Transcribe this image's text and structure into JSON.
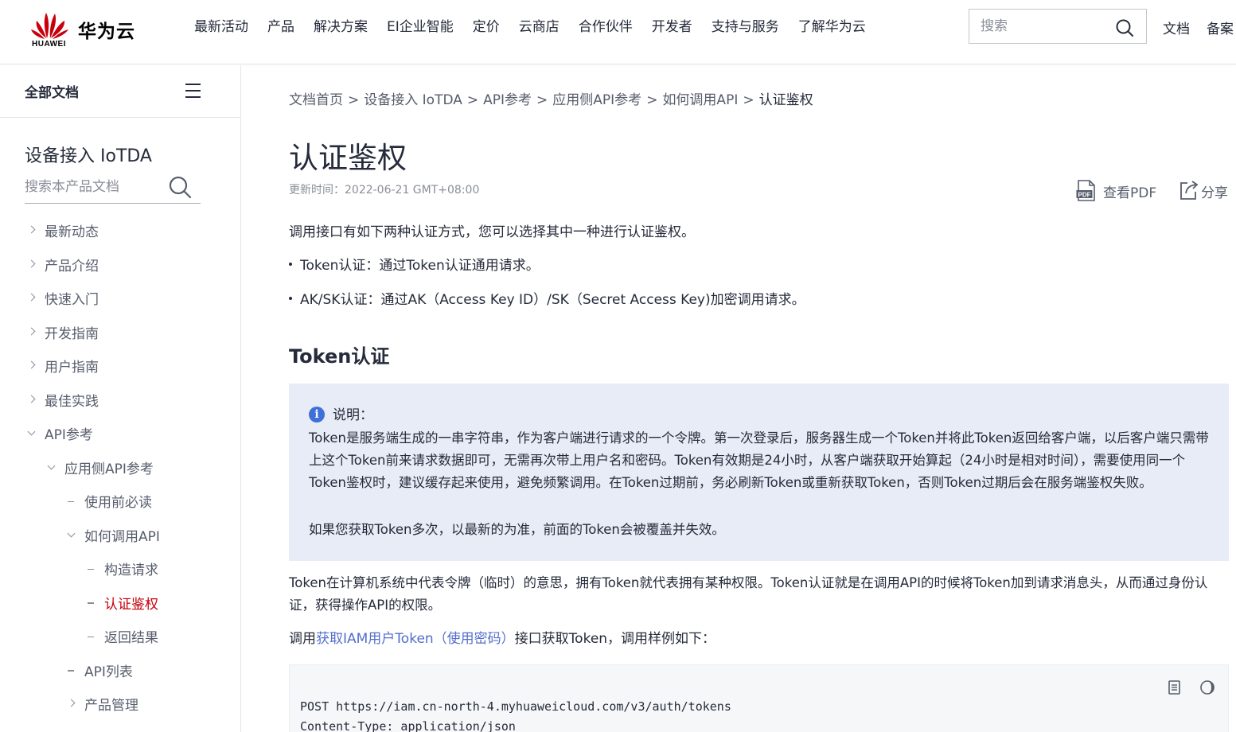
{
  "header": {
    "brand_word": "HUAWEI",
    "brand_cn": "华为云",
    "nav": [
      "最新活动",
      "产品",
      "解决方案",
      "EI企业智能",
      "定价",
      "云商店",
      "合作伙伴",
      "开发者",
      "支持与服务",
      "了解华为云"
    ],
    "search_placeholder": "搜索",
    "docs_link": "文档",
    "beian_link": "备案",
    "brand_color": "#c7000b"
  },
  "sidebar": {
    "all_docs": "全部文档",
    "product_title": "设备接入 IoTDA",
    "search_placeholder": "搜索本产品文档",
    "items": [
      {
        "label": "最新动态",
        "level": 0,
        "marker": "chevron-right"
      },
      {
        "label": "产品介绍",
        "level": 0,
        "marker": "chevron-right"
      },
      {
        "label": "快速入门",
        "level": 0,
        "marker": "chevron-right"
      },
      {
        "label": "开发指南",
        "level": 0,
        "marker": "chevron-right"
      },
      {
        "label": "用户指南",
        "level": 0,
        "marker": "chevron-right"
      },
      {
        "label": "最佳实践",
        "level": 0,
        "marker": "chevron-right"
      },
      {
        "label": "API参考",
        "level": 0,
        "marker": "chevron-down"
      },
      {
        "label": "应用侧API参考",
        "level": 1,
        "marker": "chevron-down"
      },
      {
        "label": "使用前必读",
        "level": 2,
        "marker": "dash"
      },
      {
        "label": "如何调用API",
        "level": 2,
        "marker": "chevron-down"
      },
      {
        "label": "构造请求",
        "level": 3,
        "marker": "dash"
      },
      {
        "label": "认证鉴权",
        "level": 3,
        "marker": "dash",
        "active": true
      },
      {
        "label": "返回结果",
        "level": 3,
        "marker": "dash"
      },
      {
        "label": "API列表",
        "level": 2,
        "marker": "dash"
      },
      {
        "label": "产品管理",
        "level": 2,
        "marker": "chevron-right"
      }
    ]
  },
  "main": {
    "breadcrumb": [
      "文档首页",
      "设备接入 IoTDA",
      "API参考",
      "应用侧API参考",
      "如何调用API",
      "认证鉴权"
    ],
    "breadcrumb_sep": ">",
    "title": "认证鉴权",
    "updated": "更新时间：2022-06-21 GMT+08:00",
    "pdf_label": "查看PDF",
    "share_label": "分享",
    "intro": "调用接口有如下两种认证方式，您可以选择其中一种进行认证鉴权。",
    "bullets": [
      "Token认证：通过Token认证通用请求。",
      "AK/SK认证：通过AK（Access Key ID）/SK（Secret Access Key)加密调用请求。"
    ],
    "section_title": "Token认证",
    "note": {
      "label": "说明：",
      "text1": "Token是服务端生成的一串字符串，作为客户端进行请求的一个令牌。第一次登录后，服务器生成一个Token并将此Token返回给客户端，以后客户端只需带上这个Token前来请求数据即可，无需再次带上用户名和密码。Token有效期是24小时，从客户端获取开始算起（24小时是相对时间），需要使用同一个Token鉴权时，建议缓存起来使用，避免频繁调用。在Token过期前，务必刷新Token或重新获取Token，否则Token过期后会在服务端鉴权失败。",
      "text2": "如果您获取Token多次，以最新的为准，前面的Token会被覆盖并失效。"
    },
    "para_token": "Token在计算机系统中代表令牌（临时）的意思，拥有Token就代表拥有某种权限。Token认证就是在调用API的时候将Token加到请求消息头，从而通过身份认证，获得操作API的权限。",
    "call_prefix": "调用",
    "call_link": "获取IAM用户Token（使用密码）",
    "call_suffix": "接口获取Token，调用样例如下：",
    "code_line1": "POST https://iam.cn-north-4.myhuaweicloud.com/v3/auth/tokens",
    "code_line2": "Content-Type: application/json",
    "link_color": "#526ecc",
    "note_bg": "#e8ecf6"
  }
}
